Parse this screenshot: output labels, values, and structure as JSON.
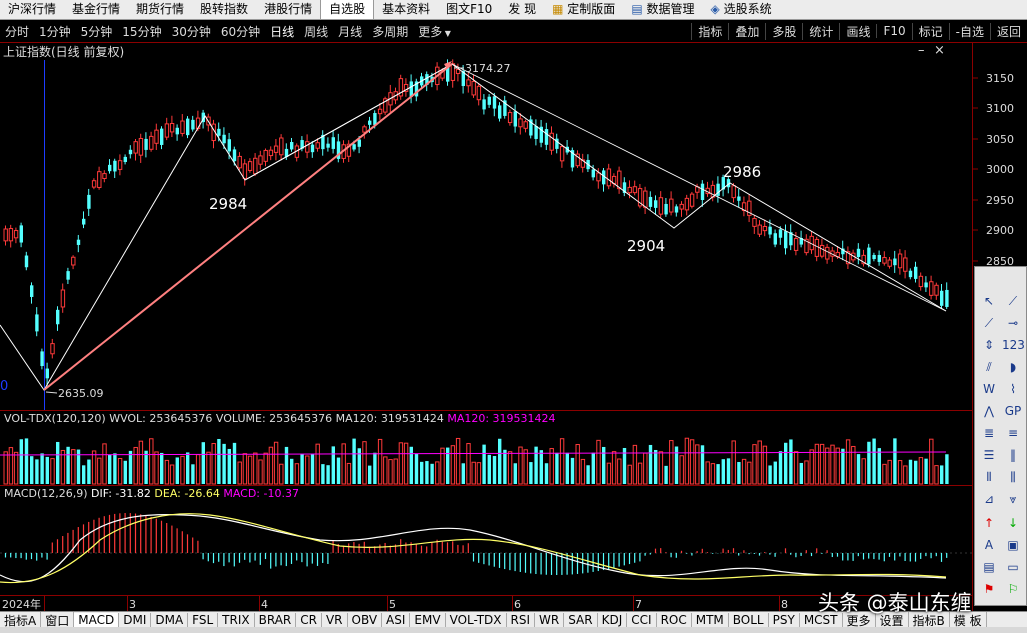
{
  "top_menu": [
    "沪深行情",
    "基金行情",
    "期货行情",
    "股转指数",
    "港股行情",
    "自选股",
    "基本资料",
    "图文F10",
    "发 现",
    "定制版面",
    "数据管理",
    "选股系统"
  ],
  "toolbar": {
    "periods": [
      "分时",
      "1分钟",
      "5分钟",
      "15分钟",
      "30分钟",
      "60分钟",
      "日线",
      "周线",
      "月线",
      "多周期",
      "更多"
    ],
    "active_period": "日线",
    "right_items": [
      "指标",
      "叠加",
      "多股",
      "统计",
      "画线",
      "F10",
      "标记",
      "-自选",
      "返回"
    ]
  },
  "title": "上证指数(日线 前复权)",
  "window_controls": {
    "minimize": "–",
    "close": "×"
  },
  "y_axis": [
    "3150",
    "3100",
    "3050",
    "3000",
    "2950",
    "2900",
    "2850"
  ],
  "annotations": {
    "high_label": "3174.27",
    "low_label": "2635.09",
    "point_a": "2984",
    "point_b": "2904",
    "point_c": "2986",
    "left_axis_zero": "0"
  },
  "volume_legend": {
    "name": "VOL-TDX(120,120)",
    "wvol": "WVOL: 253645376",
    "volume": "VOLUME: 253645376",
    "ma120a": "MA120: 319531424",
    "ma120b": "MA120: 319531424"
  },
  "macd_legend": {
    "name": "MACD(12,26,9)",
    "dif": "DIF: -31.82",
    "dea": "DEA: -26.64",
    "macd": "MACD: -10.37"
  },
  "date_axis": [
    "2024年",
    "3",
    "4",
    "5",
    "6",
    "7",
    "8"
  ],
  "bottom_tabs": [
    "指标A",
    "窗口",
    "MACD",
    "DMI",
    "DMA",
    "FSL",
    "TRIX",
    "BRAR",
    "CR",
    "VR",
    "OBV",
    "ASI",
    "EMV",
    "VOL-TDX",
    "RSI",
    "WR",
    "SAR",
    "KDJ",
    "CCI",
    "ROC",
    "MTM",
    "BOLL",
    "PSY",
    "MCST",
    "更多",
    "设置",
    "指标B",
    "模 板"
  ],
  "watermark": "头条 @泰山东缠",
  "colors": {
    "up": "#ff3a3a",
    "down": "#54ffff",
    "trend_white": "#ffffff",
    "trend_pink": "#ff8080",
    "axis_blue": "#1e3cff",
    "ma120": "#ff00ff",
    "frame": "#8b0000"
  }
}
